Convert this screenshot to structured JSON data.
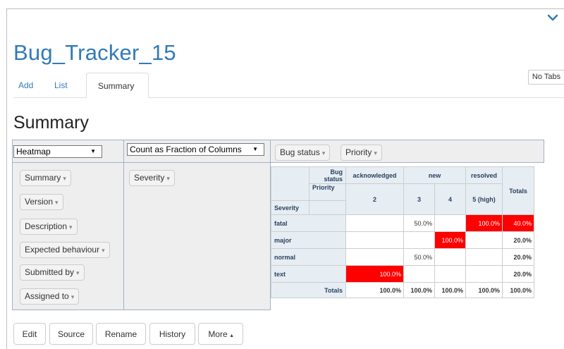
{
  "app": {
    "title": "Bug_Tracker_15",
    "tabs": [
      "Add",
      "List",
      "Summary"
    ],
    "no_tabs_label": "No Tabs",
    "section_title": "Summary"
  },
  "pivot": {
    "renderer": "Heatmap",
    "aggregator": "Count as Fraction of Columns",
    "col_attrs": [
      "Bug status",
      "Priority"
    ],
    "row_attr_active": "Severity",
    "unused_attrs": [
      "Summary",
      "Version",
      "Description",
      "Expected behaviour",
      "Submitted by",
      "Assigned to"
    ],
    "dropdown_glyph": "▾"
  },
  "table": {
    "col_header1_label": "Bug status",
    "col_header2_label": "Priority",
    "row_header_label": "Severity",
    "totals_label": "Totals",
    "status_groups": [
      {
        "label": "acknowledged",
        "span": 1
      },
      {
        "label": "new",
        "span": 2
      },
      {
        "label": "resolved",
        "span": 1
      }
    ],
    "priorities": [
      "2",
      "3",
      "4",
      "5 (high)"
    ],
    "rows": [
      {
        "label": "fatal",
        "cells": [
          "",
          "50.0%",
          "",
          "100.0%"
        ],
        "total": "40.0%"
      },
      {
        "label": "major",
        "cells": [
          "",
          "",
          "100.0%",
          ""
        ],
        "total": "20.0%"
      },
      {
        "label": "normal",
        "cells": [
          "",
          "50.0%",
          "",
          ""
        ],
        "total": "20.0%"
      },
      {
        "label": "text",
        "cells": [
          "100.0%",
          "",
          "",
          ""
        ],
        "total": "20.0%"
      }
    ],
    "col_totals": [
      "100.0%",
      "100.0%",
      "100.0%",
      "100.0%"
    ],
    "grand_total": "100.0%",
    "heat_color": "#ff0000"
  },
  "actions": {
    "edit": "Edit",
    "source": "Source",
    "rename": "Rename",
    "history": "History",
    "more": "More",
    "more_glyph": "▴"
  },
  "colors": {
    "link": "#337ab7",
    "panel_bg": "#eeeeee",
    "panel_border": "#a2b1c6"
  }
}
